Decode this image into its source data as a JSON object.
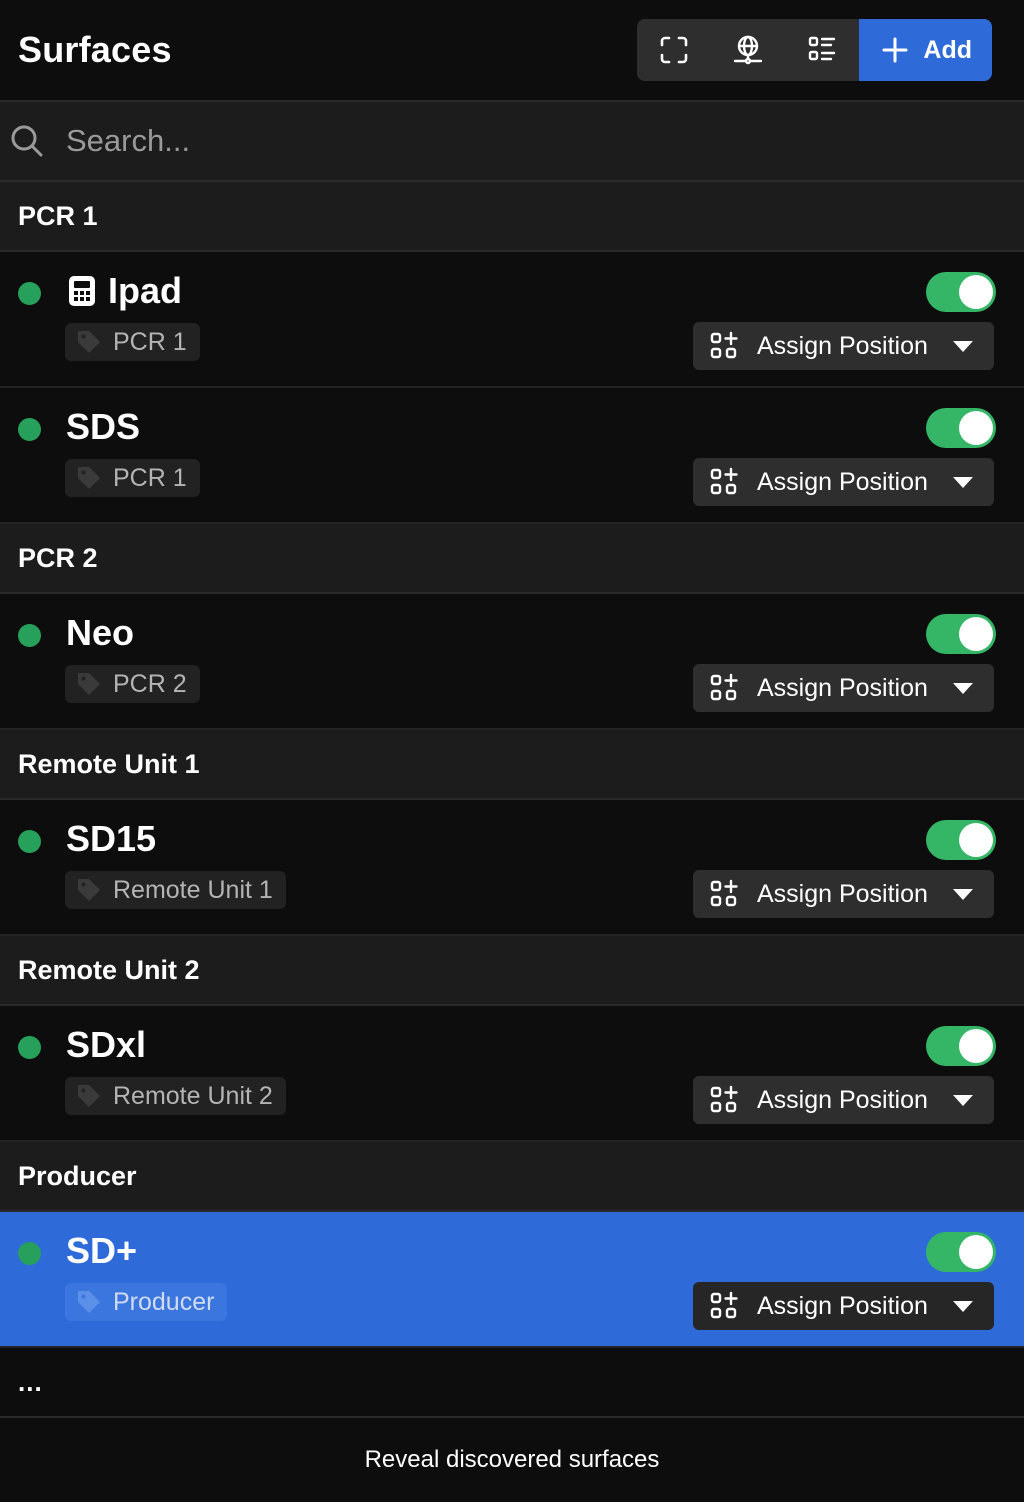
{
  "header": {
    "title": "Surfaces",
    "toolbar": {
      "icons": [
        "fullscreen-icon",
        "network-icon",
        "list-view-icon"
      ],
      "add_label": "Add"
    }
  },
  "search": {
    "placeholder": "Search..."
  },
  "groups": [
    {
      "name": "PCR 1",
      "surfaces": [
        {
          "name": "Ipad",
          "tag": "PCR 1",
          "enabled": true,
          "status": "online",
          "icon": "tablet-icon",
          "assign_label": "Assign Position"
        },
        {
          "name": "SDS",
          "tag": "PCR 1",
          "enabled": true,
          "status": "online",
          "assign_label": "Assign Position"
        }
      ]
    },
    {
      "name": "PCR 2",
      "surfaces": [
        {
          "name": "Neo",
          "tag": "PCR 2",
          "enabled": true,
          "status": "online",
          "assign_label": "Assign Position"
        }
      ]
    },
    {
      "name": "Remote Unit 1",
      "surfaces": [
        {
          "name": "SD15",
          "tag": "Remote Unit 1",
          "enabled": true,
          "status": "online",
          "assign_label": "Assign Position"
        }
      ]
    },
    {
      "name": "Remote Unit 2",
      "surfaces": [
        {
          "name": "SDxl",
          "tag": "Remote Unit 2",
          "enabled": true,
          "status": "online",
          "assign_label": "Assign Position"
        }
      ]
    },
    {
      "name": "Producer",
      "surfaces": [
        {
          "name": "SD+",
          "tag": "Producer",
          "enabled": true,
          "status": "online",
          "selected": true,
          "assign_label": "Assign Position"
        }
      ]
    }
  ],
  "more_label": "...",
  "footer": {
    "label": "Reveal discovered surfaces"
  },
  "colors": {
    "accent": "#2f6bd8",
    "status_online": "#27a05b",
    "toggle_on": "#34b666",
    "background": "#0d0d0d",
    "group_header_bg": "#1c1c1c"
  }
}
